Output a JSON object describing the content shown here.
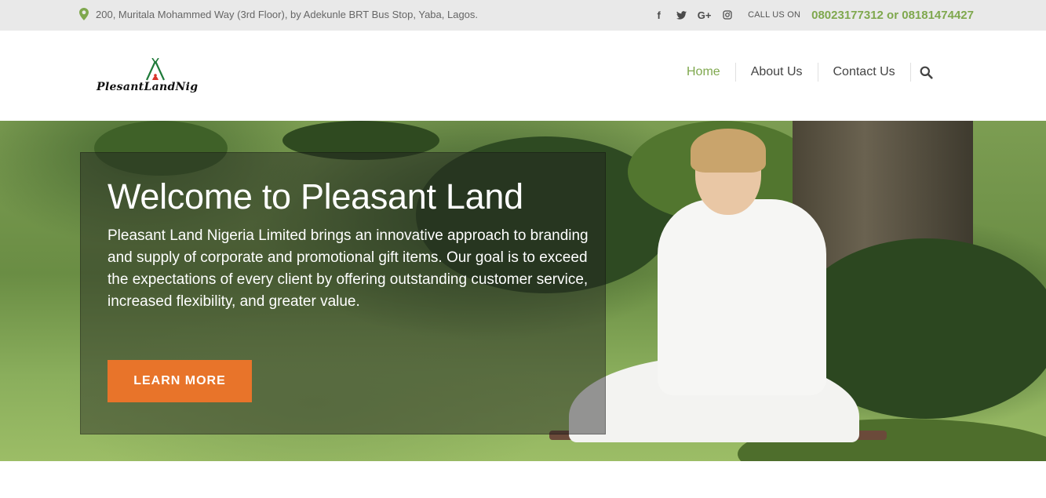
{
  "topbar": {
    "address": "200, Muritala Mohammed Way (3rd Floor), by Adekunle BRT Bus Stop, Yaba, Lagos.",
    "social": [
      {
        "icon": "facebook-icon",
        "glyph": "f"
      },
      {
        "icon": "twitter-icon",
        "glyph": "t"
      },
      {
        "icon": "google-plus-icon",
        "glyph": "G+"
      },
      {
        "icon": "instagram-icon",
        "glyph": ""
      }
    ],
    "call_label": "CALL US ON",
    "phones": "08023177312 or 08181474427"
  },
  "header": {
    "logo_text": "PlesantLandNig",
    "nav": [
      {
        "label": "Home",
        "active": true
      },
      {
        "label": "About Us",
        "active": false
      },
      {
        "label": "Contact Us",
        "active": false
      }
    ],
    "search_icon": "search-icon"
  },
  "hero": {
    "title": "Welcome to Pleasant Land",
    "body": "Pleasant Land Nigeria Limited brings an innovative approach to branding and supply of corporate and promotional gift items.  Our goal is to exceed the expectations of every client by offering outstanding customer service, increased flexibility, and greater value.",
    "cta_label": "LEARN MORE"
  },
  "colors": {
    "accent_green": "#7fa84e",
    "cta_orange": "#e8742a",
    "topbar_bg": "#e9e9e9"
  }
}
